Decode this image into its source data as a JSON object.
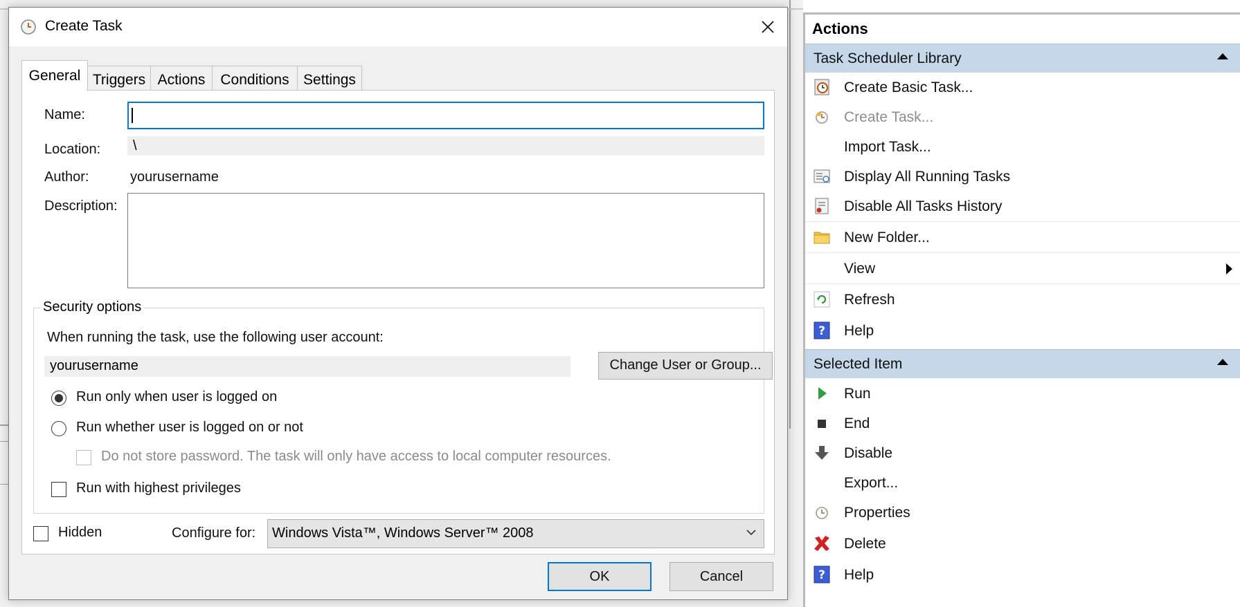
{
  "dialog": {
    "title": "Create Task",
    "tabs": [
      "General",
      "Triggers",
      "Actions",
      "Conditions",
      "Settings"
    ],
    "active_tab": "General",
    "name_label": "Name:",
    "name_value": "",
    "location_label": "Location:",
    "location_value": "\\",
    "author_label": "Author:",
    "author_value": "yourusername",
    "description_label": "Description:",
    "description_value": "",
    "security": {
      "legend": "Security options",
      "account_prompt": "When running the task, use the following user account:",
      "account_value": "yourusername",
      "change_button": "Change User or Group...",
      "radio_logged_on": "Run only when user is logged on",
      "radio_logged_on_checked": true,
      "radio_whether": "Run whether user is logged on or not",
      "radio_whether_checked": false,
      "no_store_password": "Do not store password.  The task will only have access to local computer resources.",
      "highest_privileges": "Run with highest privileges"
    },
    "hidden_label": "Hidden",
    "configure_label": "Configure for:",
    "configure_value": "Windows Vista™, Windows Server™ 2008",
    "ok": "OK",
    "cancel": "Cancel"
  },
  "actions_pane": {
    "title": "Actions",
    "library_section": "Task Scheduler Library",
    "library_items": [
      {
        "label": "Create Basic Task...",
        "icon": "create-basic-task-icon",
        "enabled": true
      },
      {
        "label": "Create Task...",
        "icon": "create-task-icon",
        "enabled": false
      },
      {
        "label": "Import Task...",
        "icon": "",
        "enabled": true
      },
      {
        "label": "Display All Running Tasks",
        "icon": "running-tasks-icon",
        "enabled": true
      },
      {
        "label": "Disable All Tasks History",
        "icon": "tasks-history-icon",
        "enabled": true
      },
      {
        "label": "New Folder...",
        "icon": "folder-icon",
        "enabled": true
      },
      {
        "label": "View",
        "icon": "",
        "enabled": true
      },
      {
        "label": "Refresh",
        "icon": "refresh-icon",
        "enabled": true
      },
      {
        "label": "Help",
        "icon": "help-icon",
        "enabled": true
      }
    ],
    "selected_section": "Selected Item",
    "selected_items": [
      {
        "label": "Run",
        "icon": "play-icon"
      },
      {
        "label": "End",
        "icon": "stop-icon"
      },
      {
        "label": "Disable",
        "icon": "down-arrow-icon"
      },
      {
        "label": "Export...",
        "icon": ""
      },
      {
        "label": "Properties",
        "icon": "clock-icon"
      },
      {
        "label": "Delete",
        "icon": "delete-icon"
      },
      {
        "label": "Help",
        "icon": "help-icon"
      }
    ]
  },
  "colors": {
    "accent": "#0078d7",
    "section_header": "#c6d7ea",
    "dialog_bg": "#f0f0f0"
  }
}
